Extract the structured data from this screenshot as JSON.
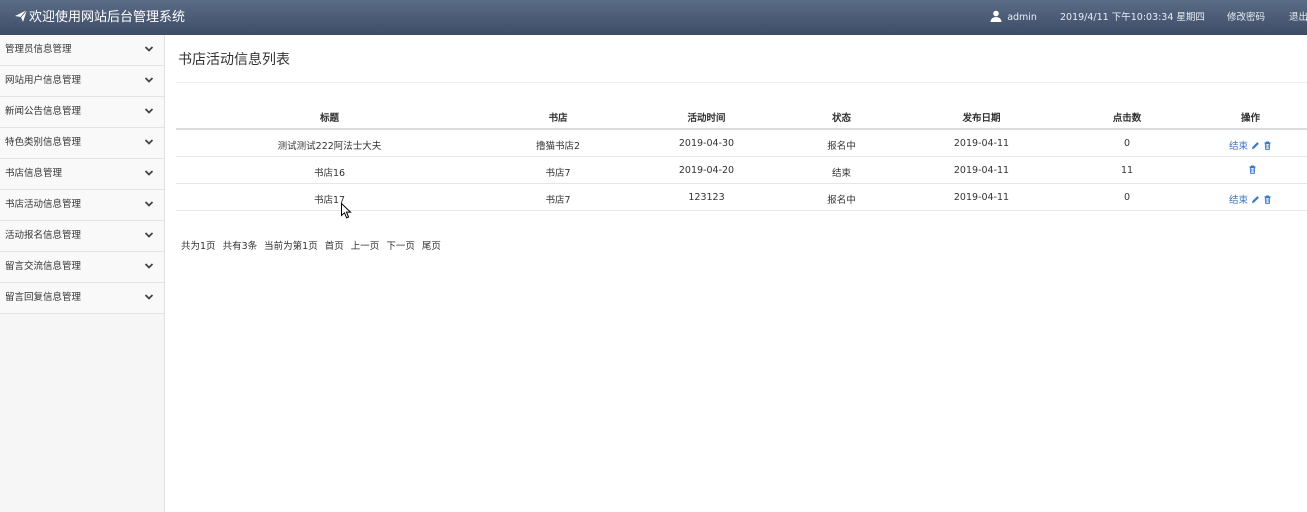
{
  "header": {
    "title": "欢迎使用网站后台管理系统",
    "user": "admin",
    "datetime": "2019/4/11 下午10:03:34 星期四",
    "change_password": "修改密码",
    "logout": "退出"
  },
  "sidebar": {
    "items": [
      {
        "label": "管理员信息管理"
      },
      {
        "label": "网站用户信息管理"
      },
      {
        "label": "新闻公告信息管理"
      },
      {
        "label": "特色类别信息管理"
      },
      {
        "label": "书店信息管理"
      },
      {
        "label": "书店活动信息管理"
      },
      {
        "label": "活动报名信息管理"
      },
      {
        "label": "留言交流信息管理"
      },
      {
        "label": "留言回复信息管理"
      }
    ]
  },
  "main": {
    "page_title": "书店活动信息列表",
    "columns": [
      "标题",
      "书店",
      "活动时间",
      "状态",
      "发布日期",
      "点击数",
      "操作"
    ],
    "rows": [
      {
        "title": "测试测试222阿法士大夫",
        "store": "撸猫书店2",
        "time": "2019-04-30",
        "status": "报名中",
        "date": "2019-04-11",
        "clicks": "0",
        "op_end": "结束",
        "show_end": true,
        "show_edit": true
      },
      {
        "title": "书店16",
        "store": "书店7",
        "time": "2019-04-20",
        "status": "结束",
        "date": "2019-04-11",
        "clicks": "11",
        "op_end": "",
        "show_end": false,
        "show_edit": false
      },
      {
        "title": "书店17",
        "store": "书店7",
        "time": "123123",
        "status": "报名中",
        "date": "2019-04-11",
        "clicks": "0",
        "op_end": "结束",
        "show_end": true,
        "show_edit": true
      }
    ],
    "pager": {
      "total_pages": "共为1页",
      "total_items": "共有3条",
      "current": "当前为第1页",
      "first": "首页",
      "prev": "上一页",
      "next": "下一页",
      "last": "尾页"
    }
  },
  "colors": {
    "header_bg": "#46556f",
    "link": "#3a78c3"
  },
  "icons": {
    "logo": "paper-plane-icon",
    "user": "user-icon",
    "sidebar_toggle": "chevron-down-icon",
    "edit": "pencil-icon",
    "delete": "trash-icon"
  }
}
